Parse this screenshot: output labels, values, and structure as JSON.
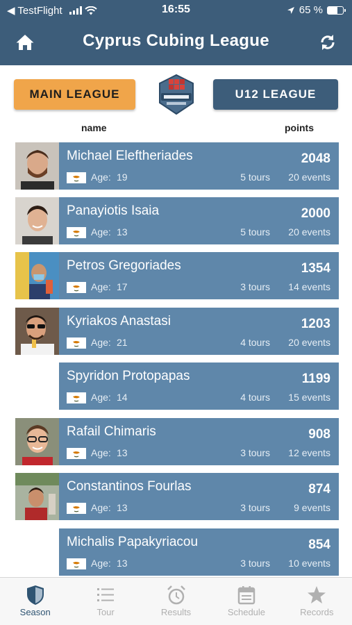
{
  "status_bar": {
    "back_app": "◀ TestFlight",
    "time": "16:55",
    "battery_percent": "65 %",
    "battery_level": 0.65
  },
  "header": {
    "title": "Cyprus Cubing League"
  },
  "league_buttons": {
    "main": "MAIN LEAGUE",
    "u12": "U12 LEAGUE"
  },
  "columns": {
    "name": "name",
    "points": "points"
  },
  "age_label": "Age:",
  "players": [
    {
      "name": "Michael Eleftheriades",
      "age": "19",
      "points": "2048",
      "tours": "5 tours",
      "events": "20 events",
      "has_photo": true
    },
    {
      "name": "Panayiotis Isaia",
      "age": "13",
      "points": "2000",
      "tours": "5 tours",
      "events": "20 events",
      "has_photo": true
    },
    {
      "name": "Petros Gregoriades",
      "age": "17",
      "points": "1354",
      "tours": "3 tours",
      "events": "14 events",
      "has_photo": true
    },
    {
      "name": "Kyriakos Anastasi",
      "age": "21",
      "points": "1203",
      "tours": "4 tours",
      "events": "20 events",
      "has_photo": true
    },
    {
      "name": "Spyridon Protopapas",
      "age": "14",
      "points": "1199",
      "tours": "4 tours",
      "events": "15 events",
      "has_photo": false
    },
    {
      "name": "Rafail Chimaris",
      "age": "13",
      "points": "908",
      "tours": "3 tours",
      "events": "12 events",
      "has_photo": true
    },
    {
      "name": "Constantinos Fourlas",
      "age": "13",
      "points": "874",
      "tours": "3 tours",
      "events": "9 events",
      "has_photo": true
    },
    {
      "name": "Michalis Papakyriacou",
      "age": "13",
      "points": "854",
      "tours": "3 tours",
      "events": "10 events",
      "has_photo": false
    }
  ],
  "tabs": [
    {
      "label": "Season",
      "icon": "shield-icon",
      "active": true
    },
    {
      "label": "Tour",
      "icon": "list-icon",
      "active": false
    },
    {
      "label": "Results",
      "icon": "alarm-clock-icon",
      "active": false
    },
    {
      "label": "Schedule",
      "icon": "calendar-icon",
      "active": false
    },
    {
      "label": "Records",
      "icon": "star-icon",
      "active": false
    }
  ],
  "colors": {
    "header_bg": "#3d5d7a",
    "main_league_bg": "#f0a54a",
    "card_bg": "#5f87aa",
    "active_tab": "#2f5472"
  }
}
